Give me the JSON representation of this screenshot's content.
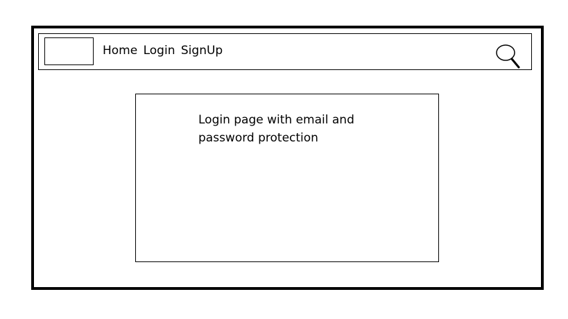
{
  "navbar": {
    "links": [
      {
        "label": "Home"
      },
      {
        "label": "Login"
      },
      {
        "label": "SignUp"
      }
    ],
    "search_icon": "search-icon"
  },
  "main": {
    "description": "Login page with email and password protection"
  }
}
